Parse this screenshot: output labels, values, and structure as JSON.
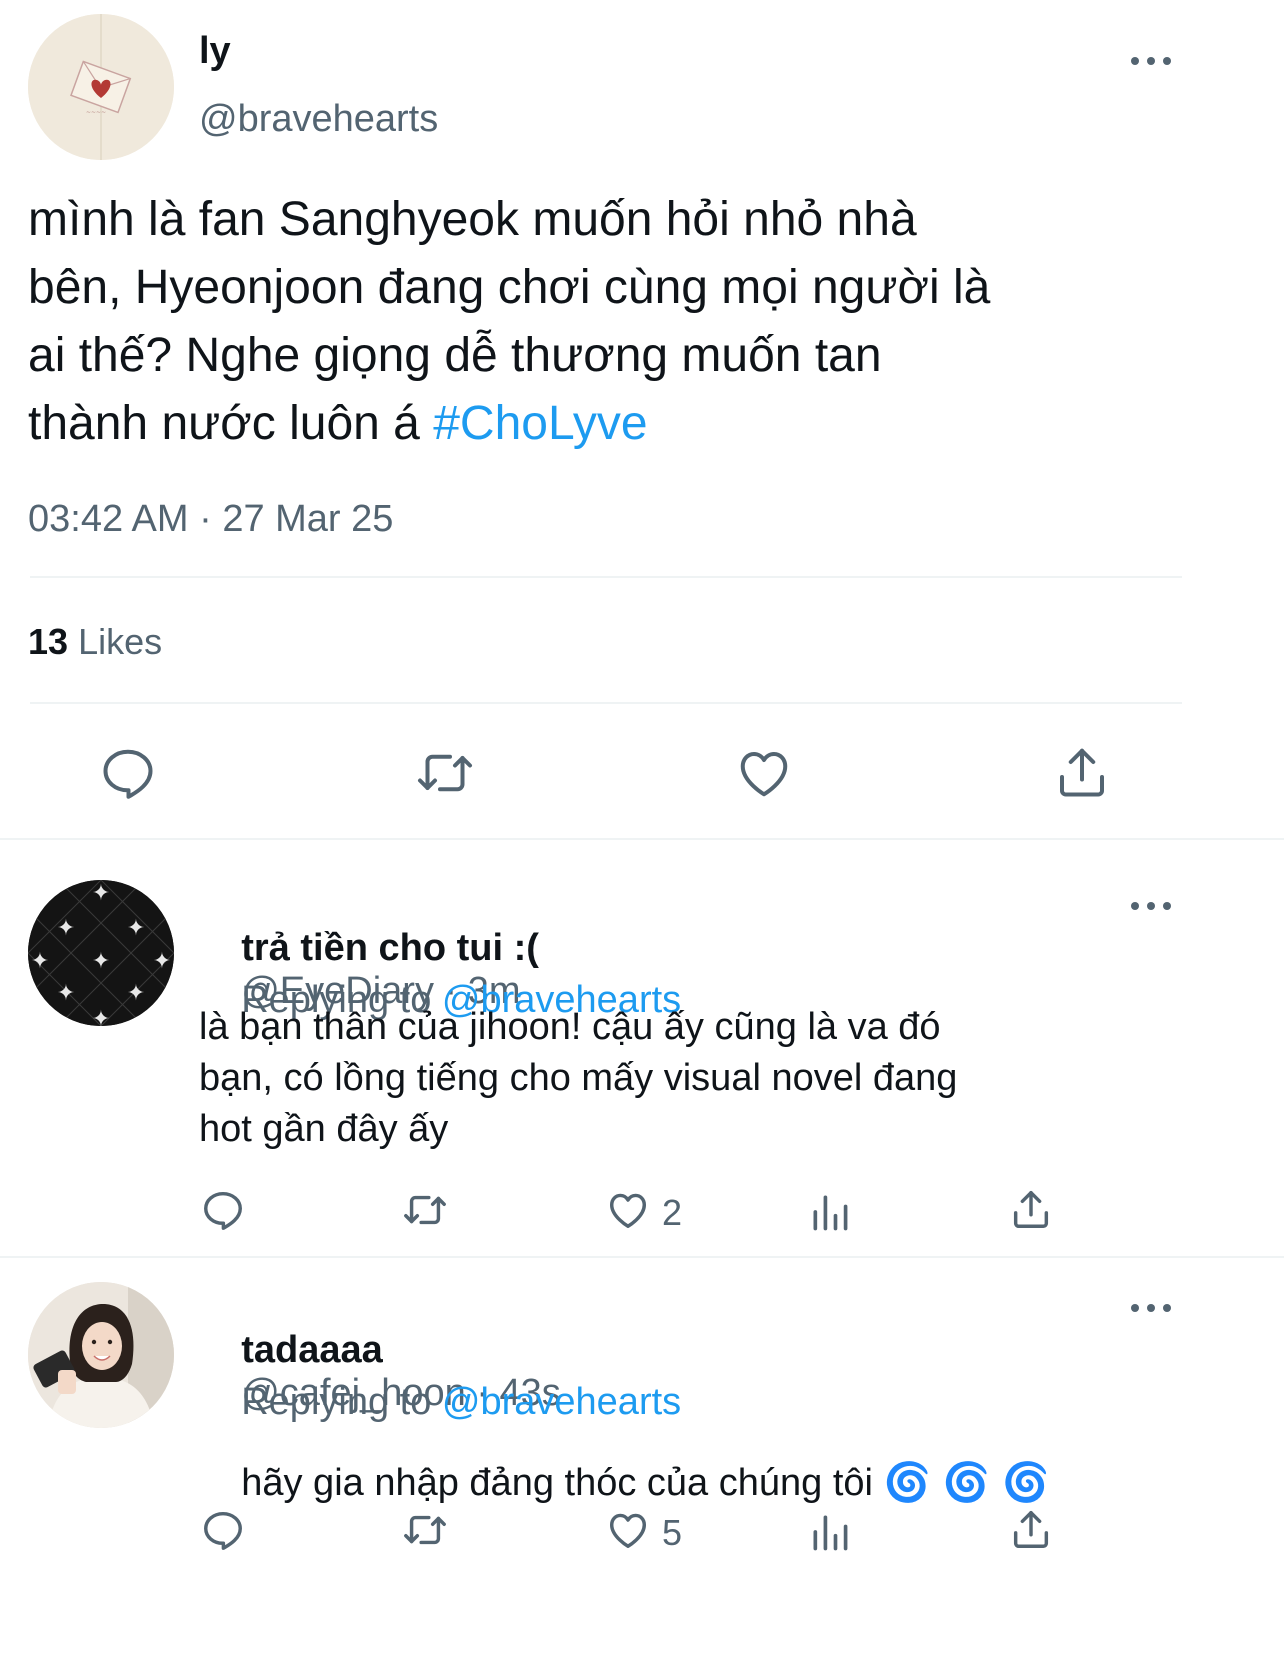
{
  "main_tweet": {
    "author_name": "ly",
    "author_handle": "@bravehearts",
    "text_lines": [
      "mình là fan Sanghyeok muốn hỏi nhỏ nhà",
      "bên, Hyeonjoon đang chơi cùng mọi người là",
      "ai thế? Nghe giọng dễ thương muốn tan",
      "thành nước luôn á "
    ],
    "hashtag": "#ChoLyve",
    "timestamp": "03:42 AM · 27 Mar 25",
    "likes_count": "13",
    "likes_label": "Likes"
  },
  "replies": [
    {
      "author_name": "trả tiền cho tui :(",
      "author_handle": "@EyeDiary",
      "time": " · 3m",
      "replying_label": "Replying to ",
      "replying_handle": "@bravehearts",
      "text_lines": [
        "là bạn thân của jihoon! cậu ấy cũng là va đó",
        "bạn, có lồng tiếng cho mấy visual novel đang",
        "hot gần đây ấy"
      ],
      "like_count": "2"
    },
    {
      "author_name": "tadaaaa",
      "author_handle": "@cafej_hoon",
      "time": " · 43s",
      "replying_label": "Replying to ",
      "replying_handle": "@bravehearts",
      "text": "hãy gia nhập đảng thóc của chúng tôi ",
      "emoji": "🌀 🌀 🌀",
      "like_count": "5"
    }
  ],
  "colors": {
    "text": "#0f1419",
    "muted": "#536471",
    "accent": "#1d9bf0",
    "divider": "#eff3f4"
  },
  "icons": [
    "more-icon",
    "reply-icon",
    "retweet-icon",
    "like-icon",
    "share-icon",
    "analytics-icon"
  ]
}
